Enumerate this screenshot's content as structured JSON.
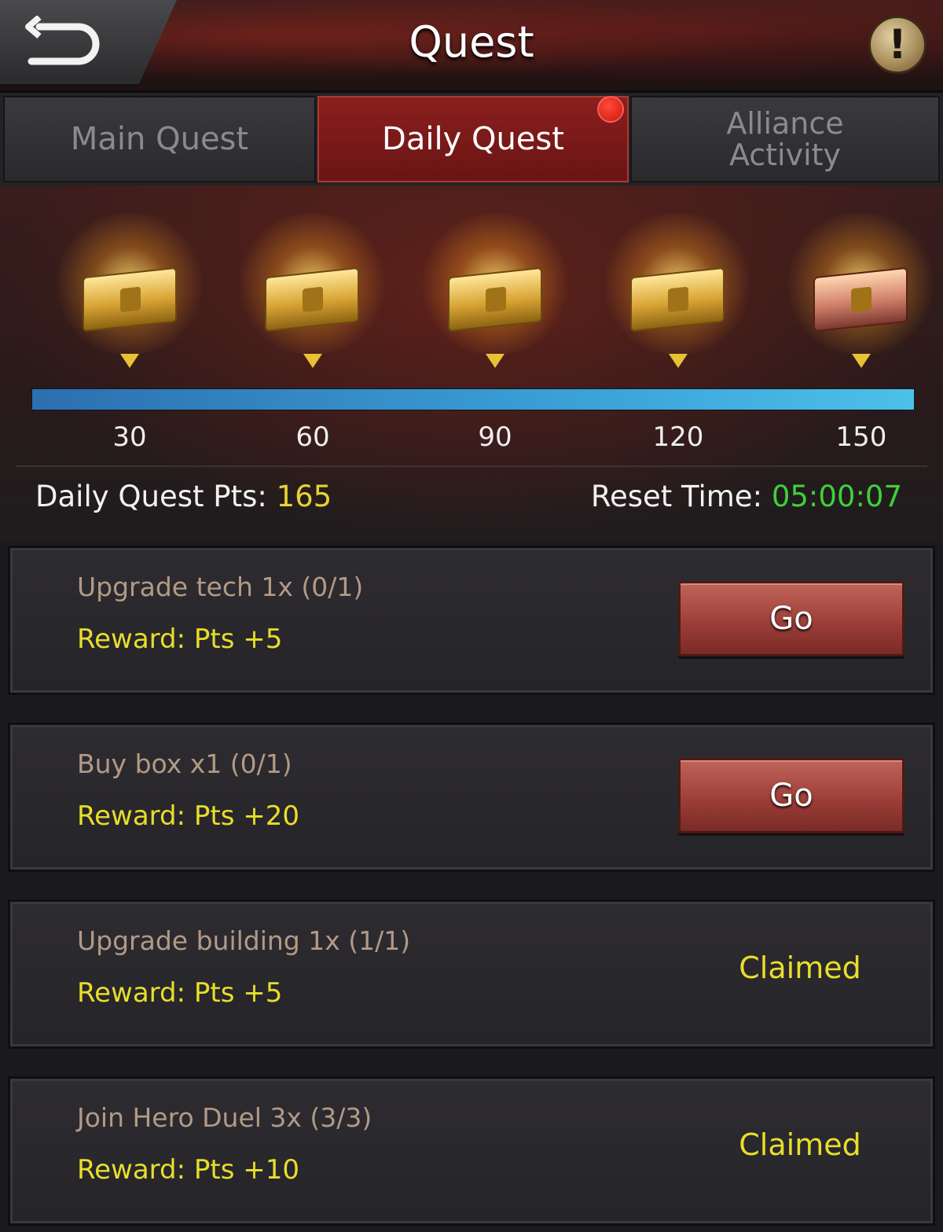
{
  "header": {
    "title": "Quest",
    "back_icon": "back-arrow-icon",
    "info_icon": "exclamation-icon",
    "info_glyph": "!"
  },
  "tabs": [
    {
      "label": "Main Quest",
      "active": false
    },
    {
      "label": "Daily Quest",
      "active": true,
      "has_notification": true
    },
    {
      "label_line1": "Alliance",
      "label_line2": "Activity",
      "active": false
    }
  ],
  "rewards": {
    "milestones": [
      "30",
      "60",
      "90",
      "120",
      "150"
    ],
    "progress_fraction": 1.0,
    "points_label": "Daily Quest Pts: ",
    "points_value": "165",
    "reset_label": "Reset Time: ",
    "reset_value": "05:00:07"
  },
  "quests": [
    {
      "name": "Upgrade tech 1x (0/1)",
      "reward": "Reward: Pts +5",
      "action": "Go",
      "status": "go"
    },
    {
      "name": "Buy box x1 (0/1)",
      "reward": "Reward: Pts +20",
      "action": "Go",
      "status": "go"
    },
    {
      "name": "Upgrade building 1x (1/1)",
      "reward": "Reward: Pts +5",
      "action": "Claimed",
      "status": "claimed"
    },
    {
      "name": "Join Hero Duel 3x (3/3)",
      "reward": "Reward: Pts +10",
      "action": "Claimed",
      "status": "claimed"
    }
  ],
  "colors": {
    "accent_yellow": "#e8de2a",
    "timer_green": "#3ed03a",
    "active_tab": "#8a1f1e",
    "progress_blue": "#3aa0d6"
  }
}
